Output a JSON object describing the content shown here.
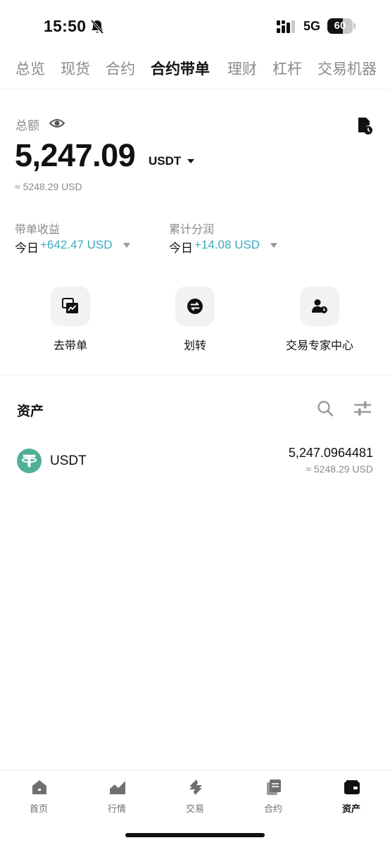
{
  "status_bar": {
    "time": "15:50",
    "network": "5G",
    "battery": "60",
    "battery_level": 0.6
  },
  "tabs": [
    {
      "label": "总览",
      "active": false
    },
    {
      "label": "现货",
      "active": false
    },
    {
      "label": "合约",
      "active": false
    },
    {
      "label": "合约带单",
      "active": true
    },
    {
      "label": "理财",
      "active": false
    },
    {
      "label": "杠杆",
      "active": false
    },
    {
      "label": "交易机器",
      "active": false
    }
  ],
  "summary": {
    "total_label": "总额",
    "total_amount": "5,247.09",
    "total_unit": "USDT",
    "total_approx": "≈ 5248.29 USD",
    "copy_profit": {
      "label": "带单收益",
      "period": "今日",
      "value": "+642.47 USD"
    },
    "profit_share": {
      "label": "累计分润",
      "period": "今日",
      "value": "+14.08 USD"
    }
  },
  "actions": [
    {
      "label": "去带单",
      "icon": "chart-window-icon"
    },
    {
      "label": "划转",
      "icon": "transfer-icon"
    },
    {
      "label": "交易专家中心",
      "icon": "expert-icon"
    }
  ],
  "assets": {
    "title": "资产",
    "items": [
      {
        "name": "USDT",
        "amount": "5,247.0964481",
        "approx": "≈ 5248.29 USD",
        "icon": "tether-icon"
      }
    ]
  },
  "bottom_nav": [
    {
      "label": "首页",
      "icon": "home-icon",
      "active": false
    },
    {
      "label": "行情",
      "icon": "market-icon",
      "active": false
    },
    {
      "label": "交易",
      "icon": "trade-icon",
      "active": false
    },
    {
      "label": "合约",
      "icon": "contract-icon",
      "active": false
    },
    {
      "label": "资产",
      "icon": "wallet-icon",
      "active": true
    }
  ],
  "colors": {
    "accent": "#3aabc2",
    "tether": "#50af95",
    "text_primary": "#111111",
    "text_secondary": "#8a8a8a"
  }
}
